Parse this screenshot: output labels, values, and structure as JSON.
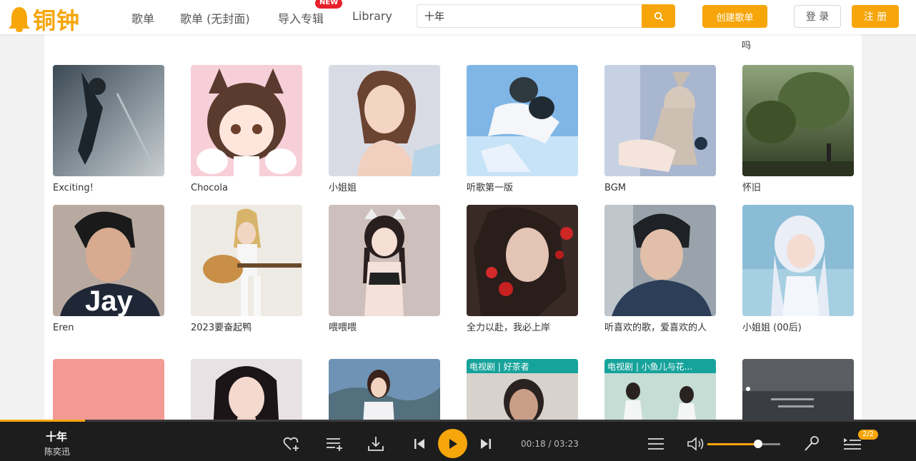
{
  "header": {
    "logo_text": "铜钟",
    "nav": [
      "歌单",
      "歌单 (无封面)",
      "导入专辑",
      "Library"
    ],
    "new_badge": "NEW",
    "search_value": "十年",
    "create_label": "创建歌单",
    "login_label": "登 录",
    "register_label": "注 册",
    "accent_color": "#f6a60b"
  },
  "prev_row_fragment": "吗",
  "playlists": [
    {
      "title": "Exciting!"
    },
    {
      "title": "Chocola"
    },
    {
      "title": "小姐姐"
    },
    {
      "title": "听歌第一版"
    },
    {
      "title": "BGM"
    },
    {
      "title": "怀旧"
    },
    {
      "title": "Eren"
    },
    {
      "title": "2023要奋起鸭"
    },
    {
      "title": "喂喂喂"
    },
    {
      "title": "全力以赴，我必上岸"
    },
    {
      "title": "听喜欢的歌，爱喜欢的人"
    },
    {
      "title": "小姐姐 (00后)"
    }
  ],
  "partial_covers": {
    "c16": "电视剧 | 好茶者",
    "c17": "电视剧 | 小鱼儿与花..."
  },
  "player": {
    "title": "十年",
    "artist": "陈奕迅",
    "time": "00:18 / 03:23",
    "progress": 0.093,
    "volume": 0.7,
    "queue": "2/2"
  }
}
